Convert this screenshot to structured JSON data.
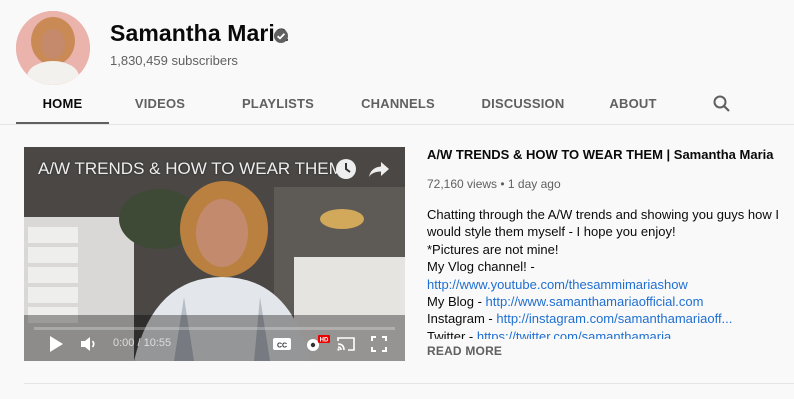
{
  "channel": {
    "name": "Samantha Maria",
    "subscribers": "1,830,459 subscribers",
    "verified_icon": "verified-check-icon",
    "avatar_color": "#e8a9a3"
  },
  "tabs": [
    {
      "label": "HOME",
      "active": true
    },
    {
      "label": "VIDEOS"
    },
    {
      "label": "PLAYLISTS"
    },
    {
      "label": "CHANNELS"
    },
    {
      "label": "DISCUSSION"
    },
    {
      "label": "ABOUT"
    }
  ],
  "search_icon": "search-icon",
  "player": {
    "overlay_title": "A/W TRENDS & HOW TO WEAR THEM |...",
    "time": "0:00 / 10:55",
    "progress": 0.0,
    "accent": "#ff0000",
    "icons": [
      "watch-later-icon",
      "share-icon",
      "play-icon",
      "volume-icon",
      "captions-icon",
      "settings-icon",
      "cast-icon",
      "fullscreen-icon"
    ],
    "hd_badge": "HD"
  },
  "video": {
    "title": "A/W TRENDS & HOW TO WEAR THEM | Samantha Maria",
    "meta": "72,160 views • 1 day ago",
    "description": {
      "line1": "Chatting through the A/W trends and showing you guys how I",
      "line2": "would style them myself - I hope you enjoy!",
      "line3": "*Pictures are not mine!",
      "line4_label": "My Vlog channel! - ",
      "line5_link": "http://www.youtube.com/thesammimariashow",
      "line6_label": "My Blog - ",
      "line6_link": "http://www.samanthamariaofficial.com",
      "line7_label": "Instagram - ",
      "line7_link": "http://instagram.com/samanthamariaoff...",
      "line8_label": "Twitter - ",
      "line8_link": "https://twitter.com/samanthamaria"
    },
    "read_more": "READ MORE",
    "link_color": "#1f6fd1"
  }
}
